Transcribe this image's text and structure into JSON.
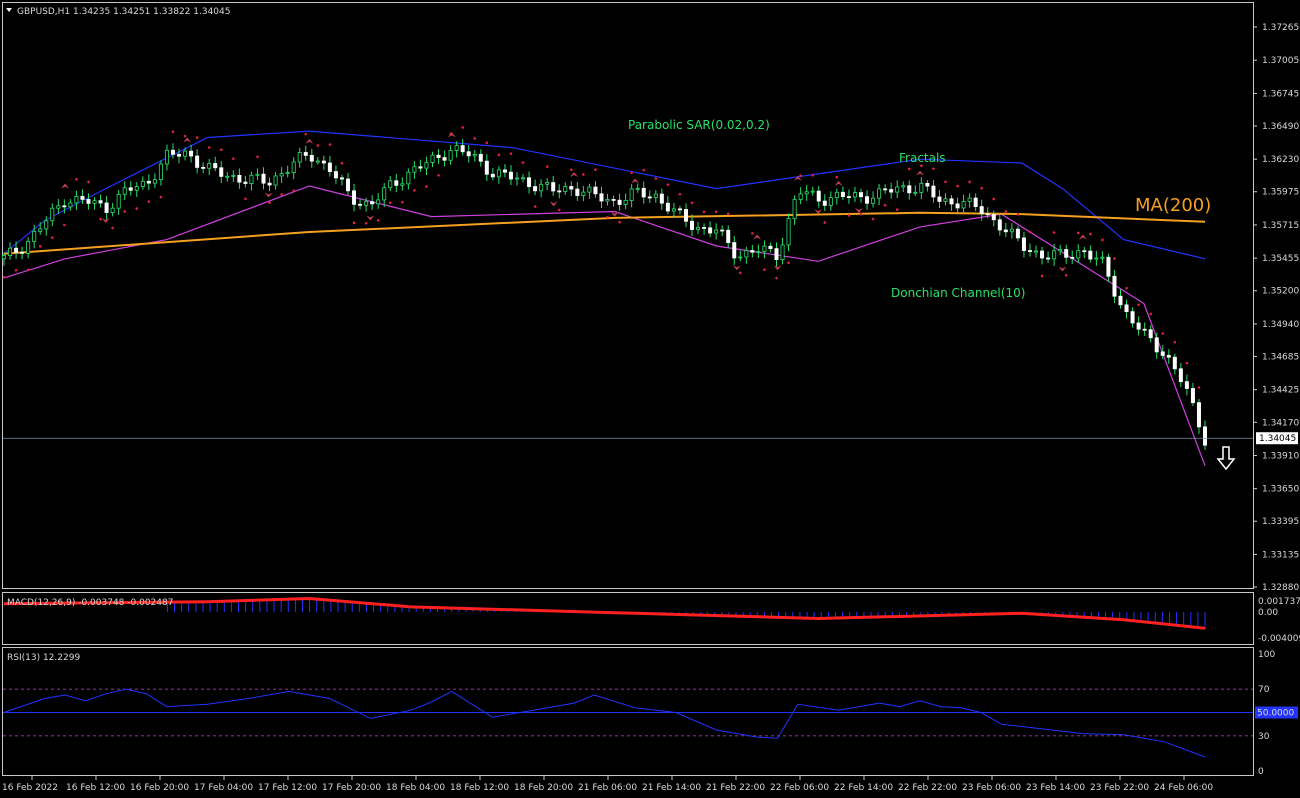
{
  "chart_data": {
    "type": "candlestick",
    "symbol_header": "GBPUSD,H1  1.34235 1.34251 1.33822 1.34045",
    "y_ticks": [
      "1.37265",
      "1.37005",
      "1.36745",
      "1.36490",
      "1.36230",
      "1.35975",
      "1.35715",
      "1.35455",
      "1.35200",
      "1.34940",
      "1.34685",
      "1.34425",
      "1.34170",
      "1.33910",
      "1.33650",
      "1.33395",
      "1.33135",
      "1.32880"
    ],
    "y_range": [
      1.3288,
      1.37265
    ],
    "current_price": "1.34045",
    "x_labels": [
      "16 Feb 2022",
      "16 Feb 12:00",
      "16 Feb 20:00",
      "17 Feb 04:00",
      "17 Feb 12:00",
      "17 Feb 20:00",
      "18 Feb 04:00",
      "18 Feb 12:00",
      "18 Feb 20:00",
      "21 Feb 06:00",
      "21 Feb 14:00",
      "21 Feb 22:00",
      "22 Feb 06:00",
      "22 Feb 14:00",
      "22 Feb 22:00",
      "23 Feb 06:00",
      "23 Feb 14:00",
      "23 Feb 22:00",
      "24 Feb 06:00"
    ],
    "annotations": {
      "psar": "Parabolic SAR(0.02,0.2)",
      "fractals": "Fractals",
      "ma": "MA(200)",
      "donchian": "Donchian Channel(10)"
    },
    "close_path": [
      [
        0,
        1.3545
      ],
      [
        6,
        1.3556
      ],
      [
        12,
        1.3573
      ],
      [
        18,
        1.3592
      ],
      [
        24,
        1.359
      ],
      [
        30,
        1.3585
      ],
      [
        36,
        1.3598
      ],
      [
        42,
        1.3604
      ],
      [
        48,
        1.3625
      ],
      [
        54,
        1.3628
      ],
      [
        60,
        1.3615
      ],
      [
        66,
        1.361
      ],
      [
        72,
        1.3607
      ],
      [
        78,
        1.3605
      ],
      [
        84,
        1.3617
      ],
      [
        90,
        1.3627
      ],
      [
        96,
        1.3616
      ],
      [
        102,
        1.3593
      ],
      [
        108,
        1.3587
      ],
      [
        114,
        1.3602
      ],
      [
        120,
        1.3614
      ],
      [
        126,
        1.3621
      ],
      [
        132,
        1.3632
      ],
      [
        138,
        1.3625
      ],
      [
        144,
        1.3613
      ],
      [
        150,
        1.3608
      ],
      [
        156,
        1.3604
      ],
      [
        162,
        1.3598
      ],
      [
        168,
        1.3601
      ],
      [
        174,
        1.3594
      ],
      [
        180,
        1.359
      ],
      [
        186,
        1.3596
      ],
      [
        192,
        1.3595
      ],
      [
        198,
        1.358
      ],
      [
        204,
        1.357
      ],
      [
        210,
        1.3567
      ],
      [
        216,
        1.3548
      ],
      [
        222,
        1.3552
      ],
      [
        228,
        1.3548
      ],
      [
        234,
        1.3598
      ],
      [
        240,
        1.3592
      ],
      [
        246,
        1.3594
      ],
      [
        252,
        1.3593
      ],
      [
        258,
        1.3596
      ],
      [
        264,
        1.36
      ],
      [
        270,
        1.3602
      ],
      [
        276,
        1.359
      ],
      [
        282,
        1.359
      ],
      [
        288,
        1.3583
      ],
      [
        294,
        1.3571
      ],
      [
        300,
        1.3555
      ],
      [
        306,
        1.3548
      ],
      [
        312,
        1.3547
      ],
      [
        318,
        1.3552
      ],
      [
        324,
        1.354
      ],
      [
        330,
        1.3505
      ],
      [
        336,
        1.3485
      ],
      [
        342,
        1.3472
      ],
      [
        348,
        1.3445
      ],
      [
        354,
        1.34045
      ]
    ],
    "ma200_path": [
      [
        0,
        1.3549
      ],
      [
        90,
        1.3566
      ],
      [
        180,
        1.3577
      ],
      [
        270,
        1.3581
      ],
      [
        300,
        1.358
      ],
      [
        354,
        1.3574
      ]
    ],
    "donchian_upper_path": [
      [
        0,
        1.3549
      ],
      [
        12,
        1.3575
      ],
      [
        30,
        1.36
      ],
      [
        60,
        1.364
      ],
      [
        90,
        1.3645
      ],
      [
        150,
        1.3632
      ],
      [
        210,
        1.36
      ],
      [
        270,
        1.3623
      ],
      [
        300,
        1.362
      ],
      [
        312,
        1.36
      ],
      [
        330,
        1.356
      ],
      [
        354,
        1.3545
      ]
    ],
    "donchian_lower_path": [
      [
        0,
        1.353
      ],
      [
        18,
        1.3545
      ],
      [
        48,
        1.356
      ],
      [
        90,
        1.3602
      ],
      [
        126,
        1.3578
      ],
      [
        180,
        1.3582
      ],
      [
        210,
        1.3555
      ],
      [
        240,
        1.3543
      ],
      [
        270,
        1.357
      ],
      [
        294,
        1.358
      ],
      [
        318,
        1.354
      ],
      [
        336,
        1.351
      ],
      [
        354,
        1.3383
      ]
    ],
    "macd": {
      "label": "MACD(12,26,9) -0.003748 -0.002487",
      "ticks": [
        "0.001737",
        "0.00",
        "-0.004009"
      ],
      "range": [
        -0.0048,
        0.0028
      ],
      "signal_path": [
        [
          0,
          0.0013
        ],
        [
          60,
          0.0016
        ],
        [
          90,
          0.0021
        ],
        [
          120,
          0.0008
        ],
        [
          180,
          -0.0001
        ],
        [
          240,
          -0.001
        ],
        [
          300,
          -0.0002
        ],
        [
          330,
          -0.0012
        ],
        [
          354,
          -0.0025
        ]
      ]
    },
    "rsi": {
      "label": "RSI(13) 12.2299",
      "ticks": [
        "100",
        "70",
        "50.0000",
        "30",
        "0"
      ],
      "range": [
        0,
        100
      ],
      "path": [
        [
          0,
          50
        ],
        [
          12,
          62
        ],
        [
          18,
          65
        ],
        [
          24,
          60
        ],
        [
          30,
          66
        ],
        [
          36,
          70
        ],
        [
          42,
          66
        ],
        [
          48,
          55
        ],
        [
          60,
          57
        ],
        [
          72,
          62
        ],
        [
          84,
          68
        ],
        [
          96,
          62
        ],
        [
          108,
          45
        ],
        [
          120,
          52
        ],
        [
          126,
          59
        ],
        [
          132,
          68
        ],
        [
          144,
          46
        ],
        [
          156,
          52
        ],
        [
          168,
          58
        ],
        [
          174,
          65
        ],
        [
          186,
          54
        ],
        [
          198,
          50
        ],
        [
          210,
          35
        ],
        [
          222,
          29
        ],
        [
          228,
          28
        ],
        [
          234,
          57
        ],
        [
          246,
          52
        ],
        [
          258,
          58
        ],
        [
          264,
          55
        ],
        [
          270,
          60
        ],
        [
          276,
          55
        ],
        [
          282,
          54
        ],
        [
          288,
          50
        ],
        [
          294,
          40
        ],
        [
          306,
          36
        ],
        [
          318,
          32
        ],
        [
          330,
          31
        ],
        [
          342,
          25
        ],
        [
          354,
          12
        ]
      ]
    }
  }
}
